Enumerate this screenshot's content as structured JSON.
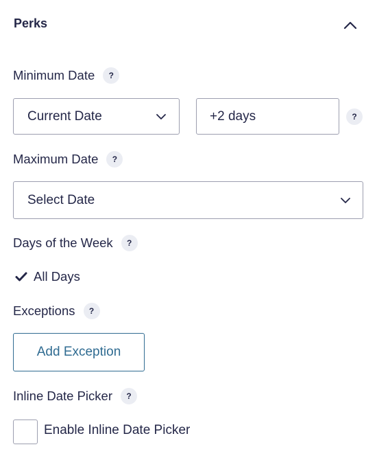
{
  "panel": {
    "title": "Perks",
    "collapse_icon": "chevron-up-icon"
  },
  "minimum_date": {
    "label": "Minimum Date",
    "help": "?",
    "select_value": "Current Date",
    "modifier_value": "+2 days",
    "modifier_help": "?"
  },
  "maximum_date": {
    "label": "Maximum Date",
    "help": "?",
    "select_value": "Select Date"
  },
  "days_of_week": {
    "label": "Days of the Week",
    "help": "?",
    "selected": "All Days"
  },
  "exceptions": {
    "label": "Exceptions",
    "help": "?",
    "add_button": "Add Exception"
  },
  "inline_picker": {
    "label": "Inline Date Picker",
    "help": "?",
    "checkbox_label": "Enable Inline Date Picker",
    "checked": false
  },
  "colors": {
    "text": "#242748",
    "border": "#9c9eaf",
    "help_bg": "#ebedf3",
    "accent": "#2f6b91"
  }
}
